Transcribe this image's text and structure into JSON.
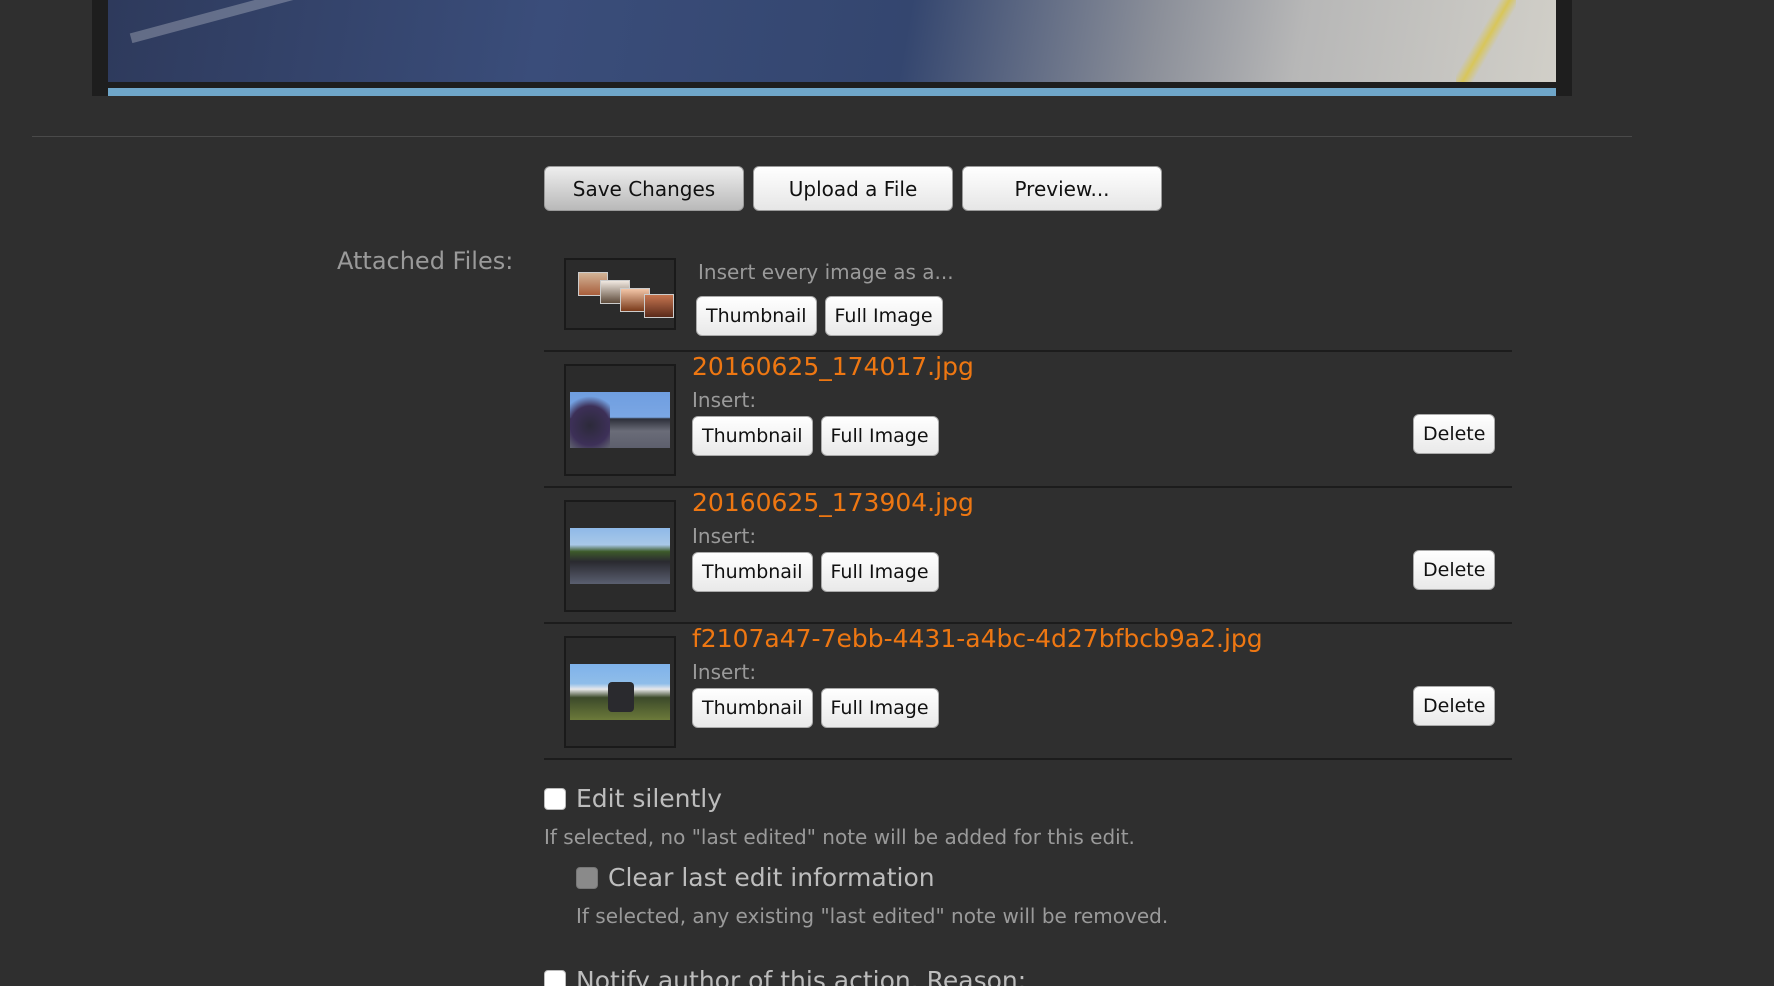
{
  "editor": {
    "colors": {
      "progress_bar": "#6fa6c9"
    }
  },
  "toolbar": {
    "save_label": "Save Changes",
    "upload_label": "Upload a File",
    "preview_label": "Preview..."
  },
  "attachments": {
    "label": "Attached Files:",
    "insert_all_text": "Insert every image as a...",
    "insert_label": "Insert:",
    "thumbnail_label": "Thumbnail",
    "full_image_label": "Full Image",
    "delete_label": "Delete",
    "files": [
      {
        "name": "20160625_174017.jpg"
      },
      {
        "name": "20160625_173904.jpg"
      },
      {
        "name": "f2107a47-7ebb-4431-a4bc-4d27bfbcb9a2.jpg"
      }
    ],
    "colors": {
      "filename": "#ee7712"
    }
  },
  "options": {
    "edit_silently_label": "Edit silently",
    "edit_silently_hint": "If selected, no \"last edited\" note will be added for this edit.",
    "clear_last_edit_label": "Clear last edit information",
    "clear_last_edit_hint": "If selected, any existing \"last edited\" note will be removed.",
    "notify_author_label": "Notify author of this action. Reason:"
  }
}
